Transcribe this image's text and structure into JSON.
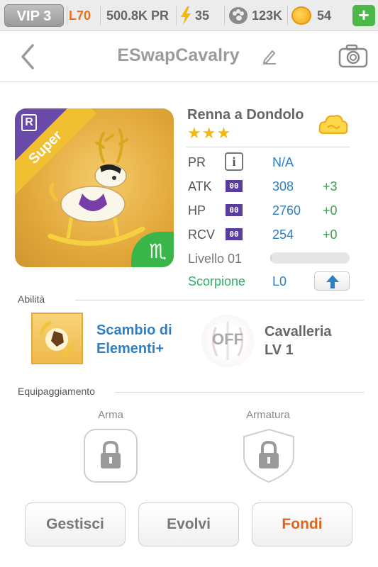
{
  "status_bar": {
    "vip": "VIP 3",
    "level": "L70",
    "pr": "500.8K PR",
    "energy": "35",
    "paws": "123K",
    "coins": "54",
    "add_icon": "plus-icon"
  },
  "header": {
    "title": "ESwapCavalry",
    "back_icon": "chevron-left-icon",
    "edit_icon": "pencil-icon",
    "camera_icon": "camera-icon"
  },
  "creature": {
    "rarity_badge": "R",
    "ribbon": "Super",
    "zodiac_symbol": "♏",
    "name": "Renna a Dondolo",
    "stars": "★★★",
    "element_icon": "cloud-icon",
    "stats": [
      {
        "label": "PR",
        "value": "N/A",
        "bonus": ""
      },
      {
        "label": "ATK",
        "badge": "00",
        "value": "308",
        "bonus": "+3"
      },
      {
        "label": "HP",
        "badge": "00",
        "value": "2760",
        "bonus": "+0"
      },
      {
        "label": "RCV",
        "badge": "00",
        "value": "254",
        "bonus": "+0"
      }
    ],
    "level_label": "Livello 01",
    "level_progress": 0.02,
    "sign_label": "Scorpione",
    "sign_value": "L0"
  },
  "abilities": {
    "section_label": "Abilità",
    "ability1": {
      "line1": "Scambio di",
      "line2": "Elementi+"
    },
    "ability2": {
      "off_label": "OFF",
      "line1": "Cavalleria",
      "line2": "LV 1"
    }
  },
  "equipment": {
    "section_label": "Equipaggiamento",
    "weapon_label": "Arma",
    "armor_label": "Armatura"
  },
  "buttons": {
    "manage": "Gestisci",
    "evolve": "Evolvi",
    "fuse": "Fondi"
  },
  "colors": {
    "accent_blue": "#2f7fc4",
    "accent_green": "#3aa14a",
    "accent_orange": "#e2641c",
    "badge_purple": "#5a3b9e",
    "star_gold": "#f2b90d"
  }
}
